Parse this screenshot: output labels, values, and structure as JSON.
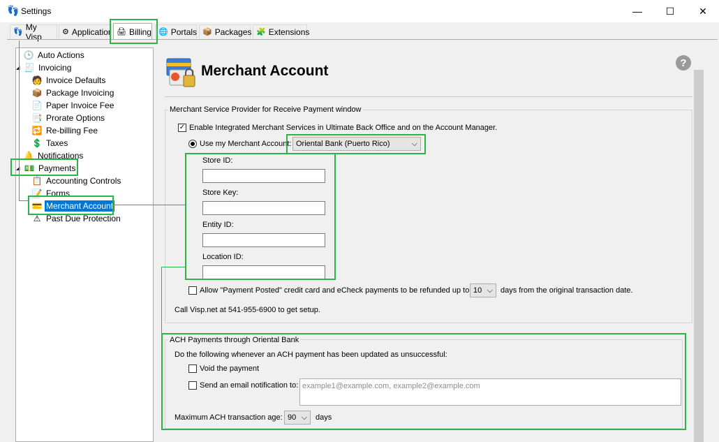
{
  "window": {
    "title": "Settings",
    "minimize": "—",
    "maximize": "☐",
    "close": "✕"
  },
  "tabs": [
    {
      "label": "My Visp",
      "icon": "👣"
    },
    {
      "label": "Application",
      "icon": "⚙"
    },
    {
      "label": "Billing",
      "icon": "🖨"
    },
    {
      "label": "Portals",
      "icon": "🌐"
    },
    {
      "label": "Packages",
      "icon": "📦"
    },
    {
      "label": "Extensions",
      "icon": "🧩"
    }
  ],
  "tree": {
    "items": [
      {
        "label": "Auto Actions",
        "icon": "🕒",
        "level": 0
      },
      {
        "label": "Invoicing",
        "icon": "🧾",
        "level": 0,
        "expander": "◢"
      },
      {
        "label": "Invoice Defaults",
        "icon": "🧑",
        "level": 1
      },
      {
        "label": "Package Invoicing",
        "icon": "📦",
        "level": 1
      },
      {
        "label": "Paper Invoice Fee",
        "icon": "📄",
        "level": 1
      },
      {
        "label": "Prorate Options",
        "icon": "📑",
        "level": 1
      },
      {
        "label": "Re-billing Fee",
        "icon": "🔁",
        "level": 1
      },
      {
        "label": "Taxes",
        "icon": "💲",
        "level": 1
      },
      {
        "label": "Notifications",
        "icon": "🔔",
        "level": 0
      },
      {
        "label": "Payments",
        "icon": "💵",
        "level": 0,
        "expander": "◢"
      },
      {
        "label": "Accounting Controls",
        "icon": "📋",
        "level": 1
      },
      {
        "label": "Forms",
        "icon": "📝",
        "level": 1
      },
      {
        "label": "Merchant Account",
        "icon": "💳",
        "level": 1,
        "selected": true
      },
      {
        "label": "Past Due Protection",
        "icon": "⚠",
        "level": 1
      }
    ]
  },
  "page": {
    "title": "Merchant Account",
    "help": "?",
    "msp_legend": "Merchant Service Provider for Receive Payment window",
    "enable_label": "Enable Integrated Merchant Services in Ultimate Back Office and on the Account Manager.",
    "enable_checked": "✓",
    "use_mine_label": "Use my Merchant Account:",
    "provider": "Oriental Bank (Puerto Rico)",
    "store_id_label": "Store ID:",
    "store_key_label": "Store Key:",
    "entity_id_label": "Entity ID:",
    "location_id_label": "Location ID:",
    "refund_pre": "Allow \"Payment Posted\" credit card and eCheck payments to be refunded up to",
    "refund_days": "10",
    "refund_post": "days from the original transaction date.",
    "call_text": "Call Visp.net at 541-955-6900 to get setup.",
    "ach_legend": "ACH Payments through Oriental Bank",
    "ach_instruction": "Do the following whenever an ACH payment has been updated as unsuccessful:",
    "void_label": "Void the payment",
    "email_label": "Send an email notification to:",
    "email_placeholder": "example1@example.com, example2@example.com",
    "max_age_label": "Maximum ACH transaction age:",
    "max_age_value": "90",
    "max_age_unit": "days",
    "chevron": "⌵"
  },
  "colors": {
    "highlight": "#2db34a",
    "selection": "#0078d7"
  }
}
